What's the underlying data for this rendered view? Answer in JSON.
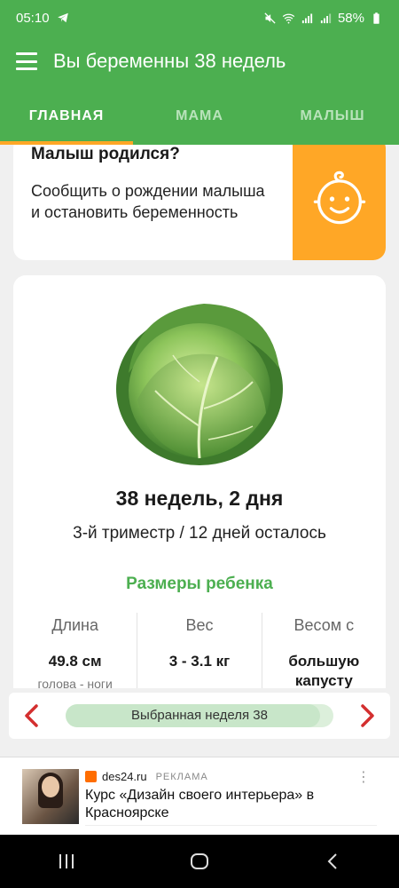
{
  "status": {
    "time": "05:10",
    "battery": "58%"
  },
  "appbar": {
    "title": "Вы беременны 38 недель"
  },
  "tabs": [
    {
      "label": "ГЛАВНАЯ",
      "active": true
    },
    {
      "label": "МАМА",
      "active": false
    },
    {
      "label": "МАЛЫШ",
      "active": false
    }
  ],
  "born_card": {
    "title": "Малыш родился?",
    "text": "Сообщить о рождении малыша и остановить беременность",
    "icon": "baby-face-icon"
  },
  "week": {
    "title": "38 недель, 2 дня",
    "trimester": "3-й триместр / 12 дней осталось",
    "sizes_title": "Размеры ребенка",
    "stats": [
      {
        "label": "Длина",
        "value": "49.8 см",
        "sub": "голова - ноги"
      },
      {
        "label": "Вес",
        "value": "3 - 3.1 кг",
        "sub": ""
      },
      {
        "label": "Весом с",
        "value": "большую капусту",
        "sub": ""
      }
    ]
  },
  "week_nav": {
    "label": "Выбранная неделя 38",
    "progress": 0.95
  },
  "ad": {
    "source": "des24.ru",
    "tag": "РЕКЛАМА",
    "title": "Курс «Дизайн своего интерьера» в Красноярске",
    "more": "⋮"
  },
  "colors": {
    "primary": "#4caf50",
    "accent": "#ffa726",
    "arrow": "#d32f2f"
  }
}
